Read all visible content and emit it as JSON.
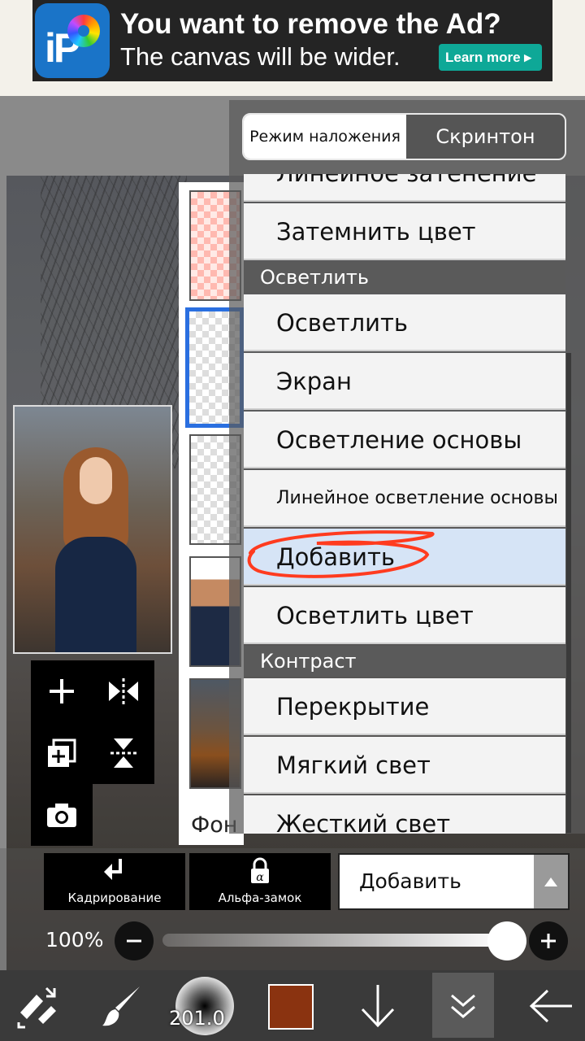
{
  "ad": {
    "title": "You want to remove the Ad?",
    "subtitle": "The canvas will be wider.",
    "button": "Learn more ▸",
    "logo_text": "iP"
  },
  "blend_panel": {
    "mode_blend": "Режим наложения",
    "mode_screentone": "Скринтон",
    "items": [
      {
        "type": "option",
        "label": "Линейное затенение"
      },
      {
        "type": "option",
        "label": "Затемнить цвет"
      },
      {
        "type": "category",
        "label": "Осветлить"
      },
      {
        "type": "option",
        "label": "Осветлить"
      },
      {
        "type": "option",
        "label": "Экран"
      },
      {
        "type": "option",
        "label": "Осветление основы"
      },
      {
        "type": "option",
        "label": "Линейное осветление основы"
      },
      {
        "type": "option",
        "label": "Добавить",
        "selected": true
      },
      {
        "type": "option",
        "label": "Осветлить цвет"
      },
      {
        "type": "category",
        "label": "Контраст"
      },
      {
        "type": "option",
        "label": "Перекрытие"
      },
      {
        "type": "option",
        "label": "Мягкий свет"
      },
      {
        "type": "option",
        "label": "Жесткий свет"
      }
    ],
    "annotation_color": "#ff3b1f"
  },
  "layers": {
    "background_label": "Фон"
  },
  "controls": {
    "crop_label": "Кадрирование",
    "alpha_lock_label": "Альфа-замок",
    "blend_value": "Добавить",
    "opacity_label": "100%",
    "opacity_value": 100
  },
  "toolbar": {
    "brush_size": "201.0",
    "color": "#8a3310"
  },
  "icons": {
    "add_layer": "plus-icon",
    "flip_h": "flip-horizontal-icon",
    "duplicate": "duplicate-layer-icon",
    "flip_v": "flip-vertical-icon",
    "camera": "camera-icon",
    "crop": "crop-arrow-icon",
    "alpha_lock": "lock-icon",
    "tool_switch": "tool-switch-icon",
    "brush": "brush-icon",
    "move_down": "arrow-down-icon",
    "layer_menu": "double-chevron-down-icon",
    "back": "arrow-left-icon"
  }
}
